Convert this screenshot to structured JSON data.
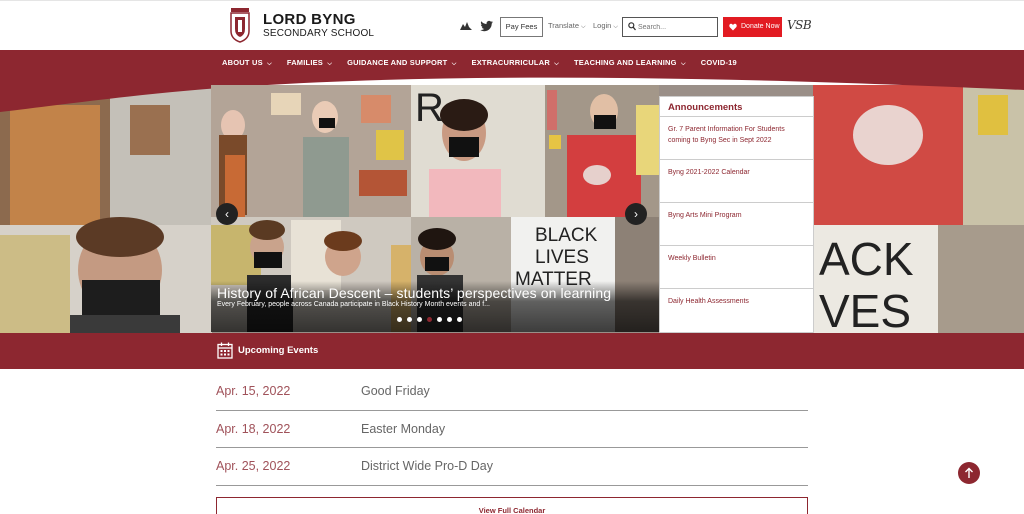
{
  "header": {
    "school_name_line1": "LORD BYNG",
    "school_name_line2": "SECONDARY SCHOOL",
    "pay_fees_label": "Pay Fees",
    "translate_label": "Translate",
    "login_label": "Login",
    "search_placeholder": "Search...",
    "donate_label": "Donate Now",
    "vsb_label": "VSB"
  },
  "nav": {
    "items": [
      {
        "label": "ABOUT US",
        "has_dropdown": true
      },
      {
        "label": "FAMILIES",
        "has_dropdown": true
      },
      {
        "label": "GUIDANCE AND SUPPORT",
        "has_dropdown": true
      },
      {
        "label": "EXTRACURRICULAR",
        "has_dropdown": true
      },
      {
        "label": "TEACHING AND LEARNING",
        "has_dropdown": true
      },
      {
        "label": "COVID-19",
        "has_dropdown": false
      }
    ]
  },
  "slider": {
    "title": "History of African Descent – students’ perspectives on learning",
    "subtitle": "Every February, people across Canada participate in Black History Month events and f...",
    "slide_count": 7,
    "active_slide": 4,
    "sign_text": [
      "BLACK",
      "LIVES",
      "MATTER"
    ]
  },
  "announcements": {
    "title": "Announcements",
    "items": [
      "Gr. 7 Parent Information For Students coming to Byng Sec in Sept 2022",
      "Byng 2021-2022 Calendar",
      "Byng Arts Mini Program",
      "Weekly Bulletin",
      "Daily Health Assessments"
    ]
  },
  "events": {
    "title": "Upcoming Events",
    "rows": [
      {
        "date": "Apr. 15, 2022",
        "name": "Good Friday"
      },
      {
        "date": "Apr. 18, 2022",
        "name": "Easter Monday"
      },
      {
        "date": "Apr. 25, 2022",
        "name": "District Wide Pro-D Day"
      }
    ],
    "view_full_label": "View Full Calendar"
  },
  "colors": {
    "brand": "#8d2730",
    "donate": "#e21b22",
    "event_date": "#a0525a"
  },
  "icons": {
    "school_crest": "crest-icon",
    "bird": "bird-icon",
    "twitter": "twitter-icon",
    "search": "search-icon",
    "heart": "heart-icon",
    "calendar": "calendar-icon",
    "back_to_top": "arrow-up-icon"
  }
}
